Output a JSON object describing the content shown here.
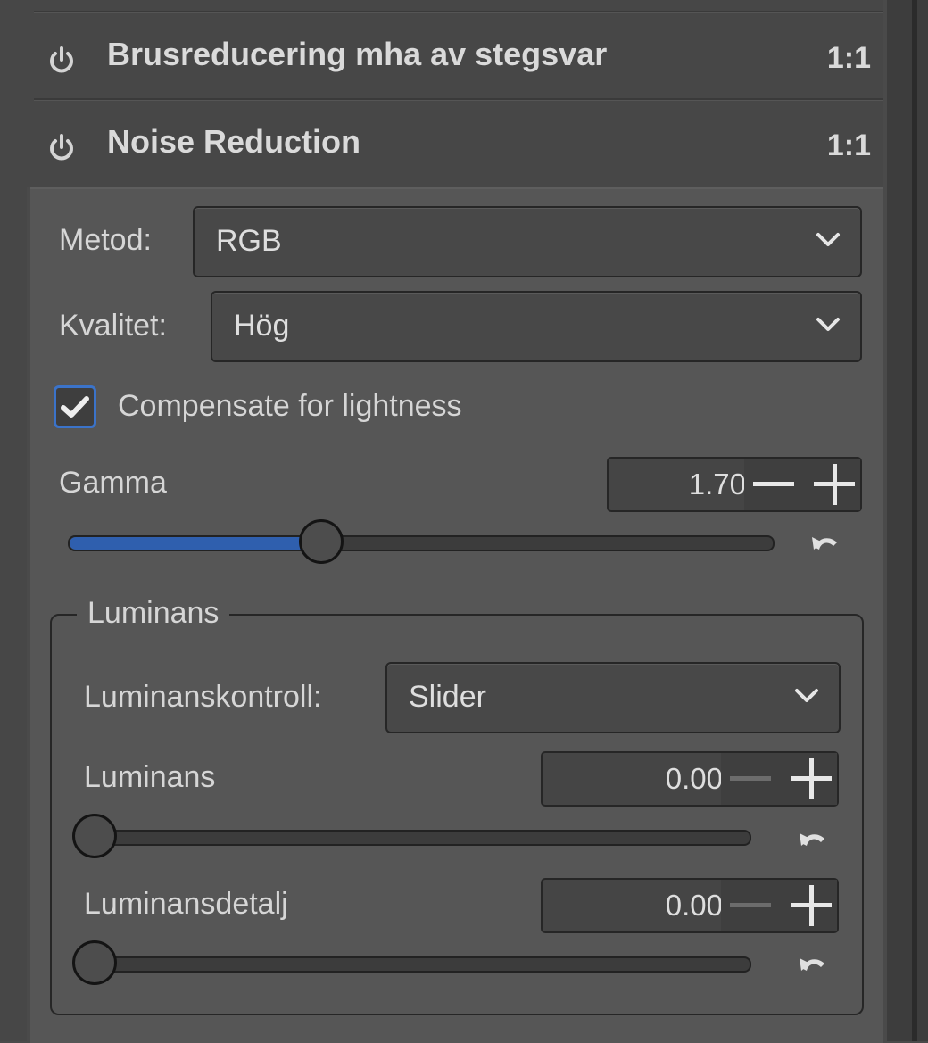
{
  "panels": [
    {
      "title": "Brusreducering mha av stegsvar",
      "ratio": "1:1",
      "icon": "power-icon"
    },
    {
      "title": "Noise Reduction",
      "ratio": "1:1",
      "icon": "power-icon"
    }
  ],
  "method": {
    "label": "Metod:",
    "value": "RGB"
  },
  "quality": {
    "label": "Kvalitet:",
    "value": "Hög"
  },
  "compensate": {
    "label": "Compensate for lightness",
    "checked": true
  },
  "gamma": {
    "label": "Gamma",
    "value": "1.70",
    "level": 0.36
  },
  "luminance_group": {
    "legend": "Luminans",
    "control": {
      "label": "Luminanskontroll:",
      "value": "Slider"
    },
    "luminance": {
      "label": "Luminans",
      "value": "0.00",
      "level": 0
    },
    "detail": {
      "label": "Luminansdetalj",
      "value": "0.00",
      "level": 0
    }
  },
  "colors": {
    "accent": "#2f5fae",
    "checkbox_border": "#3b73c9",
    "panel_bg": "#565656"
  }
}
